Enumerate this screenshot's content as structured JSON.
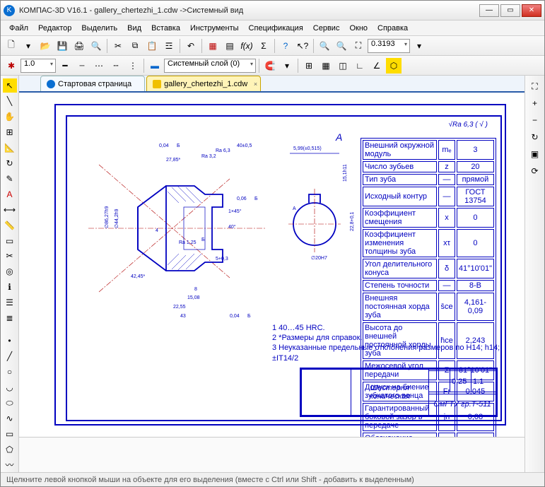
{
  "window": {
    "title": "КОМПАС-3D V16.1 - gallery_chertezhi_1.cdw ->Системный вид",
    "app_icon": "K"
  },
  "menu": [
    "Файл",
    "Редактор",
    "Выделить",
    "Вид",
    "Вставка",
    "Инструменты",
    "Спецификация",
    "Сервис",
    "Окно",
    "Справка"
  ],
  "toolbar1_icons": [
    "new",
    "open",
    "save",
    "print",
    "preview",
    "cut",
    "copy",
    "paste",
    "props",
    "cancel",
    "vars",
    "table",
    "fx",
    "sigma",
    "help",
    "arrow"
  ],
  "zoom": {
    "value": "0.3193"
  },
  "line_weight": {
    "value": "1.0"
  },
  "layer_combo": {
    "value": "Системный слой (0)"
  },
  "tabs": [
    {
      "label": "Стартовая страница",
      "active": false
    },
    {
      "label": "gallery_chertezhi_1.cdw",
      "active": true
    }
  ],
  "drawing": {
    "section_label": "А",
    "section_arrow": "А",
    "surface_finish": "√Ra 6,3 ( √ )",
    "dims": {
      "d1": "0,04",
      "d2": "Б",
      "d3": "27,85*",
      "d4": "Ra 3,2",
      "d5": "Ra 6,3",
      "d6": "40±0,5",
      "d7": "0,06",
      "d8": "Б",
      "d9": "1×45°",
      "d10": "40°",
      "d11": "Ra 1,25",
      "d12": "Б",
      "d13": "5+0,3",
      "d14": "8",
      "d15": "15,08",
      "d16": "22,55",
      "d17": "43",
      "d18": "0,04",
      "d19": "Б",
      "d20": "∅44,2h9",
      "d21": "42,45*",
      "d22": "4",
      "d23": "∅86,27h9",
      "d24": "5,99(±0,515)",
      "d25": "22,8+0,1",
      "d26": "∅20H7",
      "d27": "15,1h11"
    },
    "part_title": "Шестерня коническая",
    "part_code": "ОмГТУ гр.Т-511",
    "scale": "1:1",
    "mass": "0,25",
    "params": [
      [
        "Внешний окружной модуль",
        "mₑ",
        "3"
      ],
      [
        "Число зубьев",
        "z",
        "20"
      ],
      [
        "Тип зуба",
        "—",
        "прямой"
      ],
      [
        "Исходный контур",
        "—",
        "ГОСТ 13754"
      ],
      [
        "Коэффициент смещения",
        "x",
        "0"
      ],
      [
        "Коэффициент изменения толщины зуба",
        "xτ",
        "0"
      ],
      [
        "Угол делительного конуса",
        "δ",
        "41°10'01\""
      ],
      [
        "Степень точности",
        "—",
        "8-В"
      ],
      [
        "Внешняя постоянная хорда зуба",
        "s̄ce",
        "4,161-0,09"
      ],
      [
        "Высота до внешней постоянной хорды зуба",
        "h̄ce",
        "2,243"
      ],
      [
        "Межосевой угол передачи",
        "Σ",
        "81°10'01\""
      ],
      [
        "Допуск на биение зубчатого венца",
        "Fr",
        "0,045"
      ],
      [
        "Гарантированный боковой зазор в передаче",
        "jn",
        "0,08"
      ],
      [
        "Обозначение сопряженного зубчатого колеса",
        "—",
        ""
      ]
    ],
    "notes": [
      "1 40…45 HRC.",
      "2 *Размеры для справок.",
      "3 Неуказанные предельные отклонения размеров по H14; h14; ±IT14/2"
    ]
  },
  "status": {
    "text": "Щелкните левой кнопкой мыши на объекте для его выделения (вместе с Ctrl или Shift - добавить к выделенным)"
  }
}
